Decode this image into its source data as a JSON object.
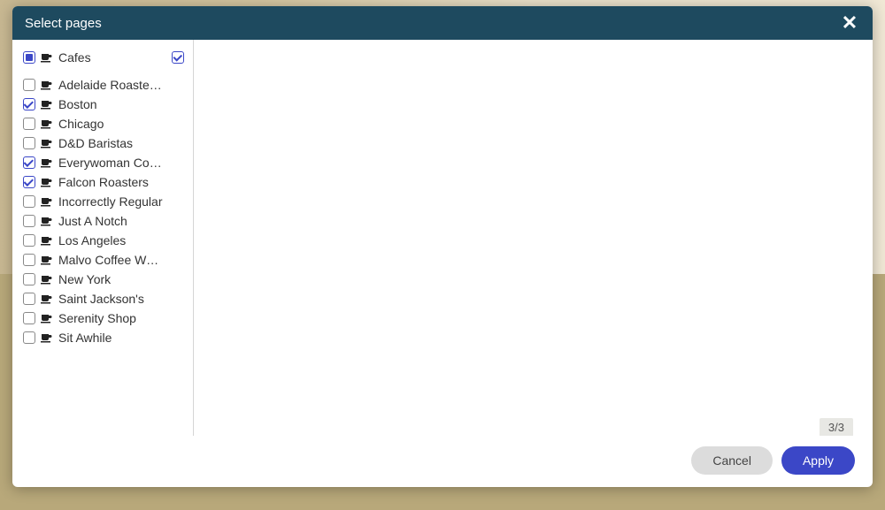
{
  "modal": {
    "title": "Select pages",
    "count_text": "3/3",
    "cancel_label": "Cancel",
    "apply_label": "Apply"
  },
  "tree": {
    "parent": {
      "label": "Cafes",
      "state": "partial"
    },
    "children": [
      {
        "label": "Adelaide Roastery ...",
        "checked": false
      },
      {
        "label": "Boston",
        "checked": true
      },
      {
        "label": "Chicago",
        "checked": false
      },
      {
        "label": "D&D Baristas",
        "checked": false
      },
      {
        "label": "Everywoman Coffee...",
        "checked": true
      },
      {
        "label": "Falcon Roasters",
        "checked": true
      },
      {
        "label": "Incorrectly Regular",
        "checked": false
      },
      {
        "label": "Just A Notch",
        "checked": false
      },
      {
        "label": "Los Angeles",
        "checked": false
      },
      {
        "label": "Malvo Coffee Works",
        "checked": false
      },
      {
        "label": "New York",
        "checked": false
      },
      {
        "label": "Saint Jackson's",
        "checked": false
      },
      {
        "label": "Serenity Shop",
        "checked": false
      },
      {
        "label": "Sit Awhile",
        "checked": false
      }
    ]
  }
}
